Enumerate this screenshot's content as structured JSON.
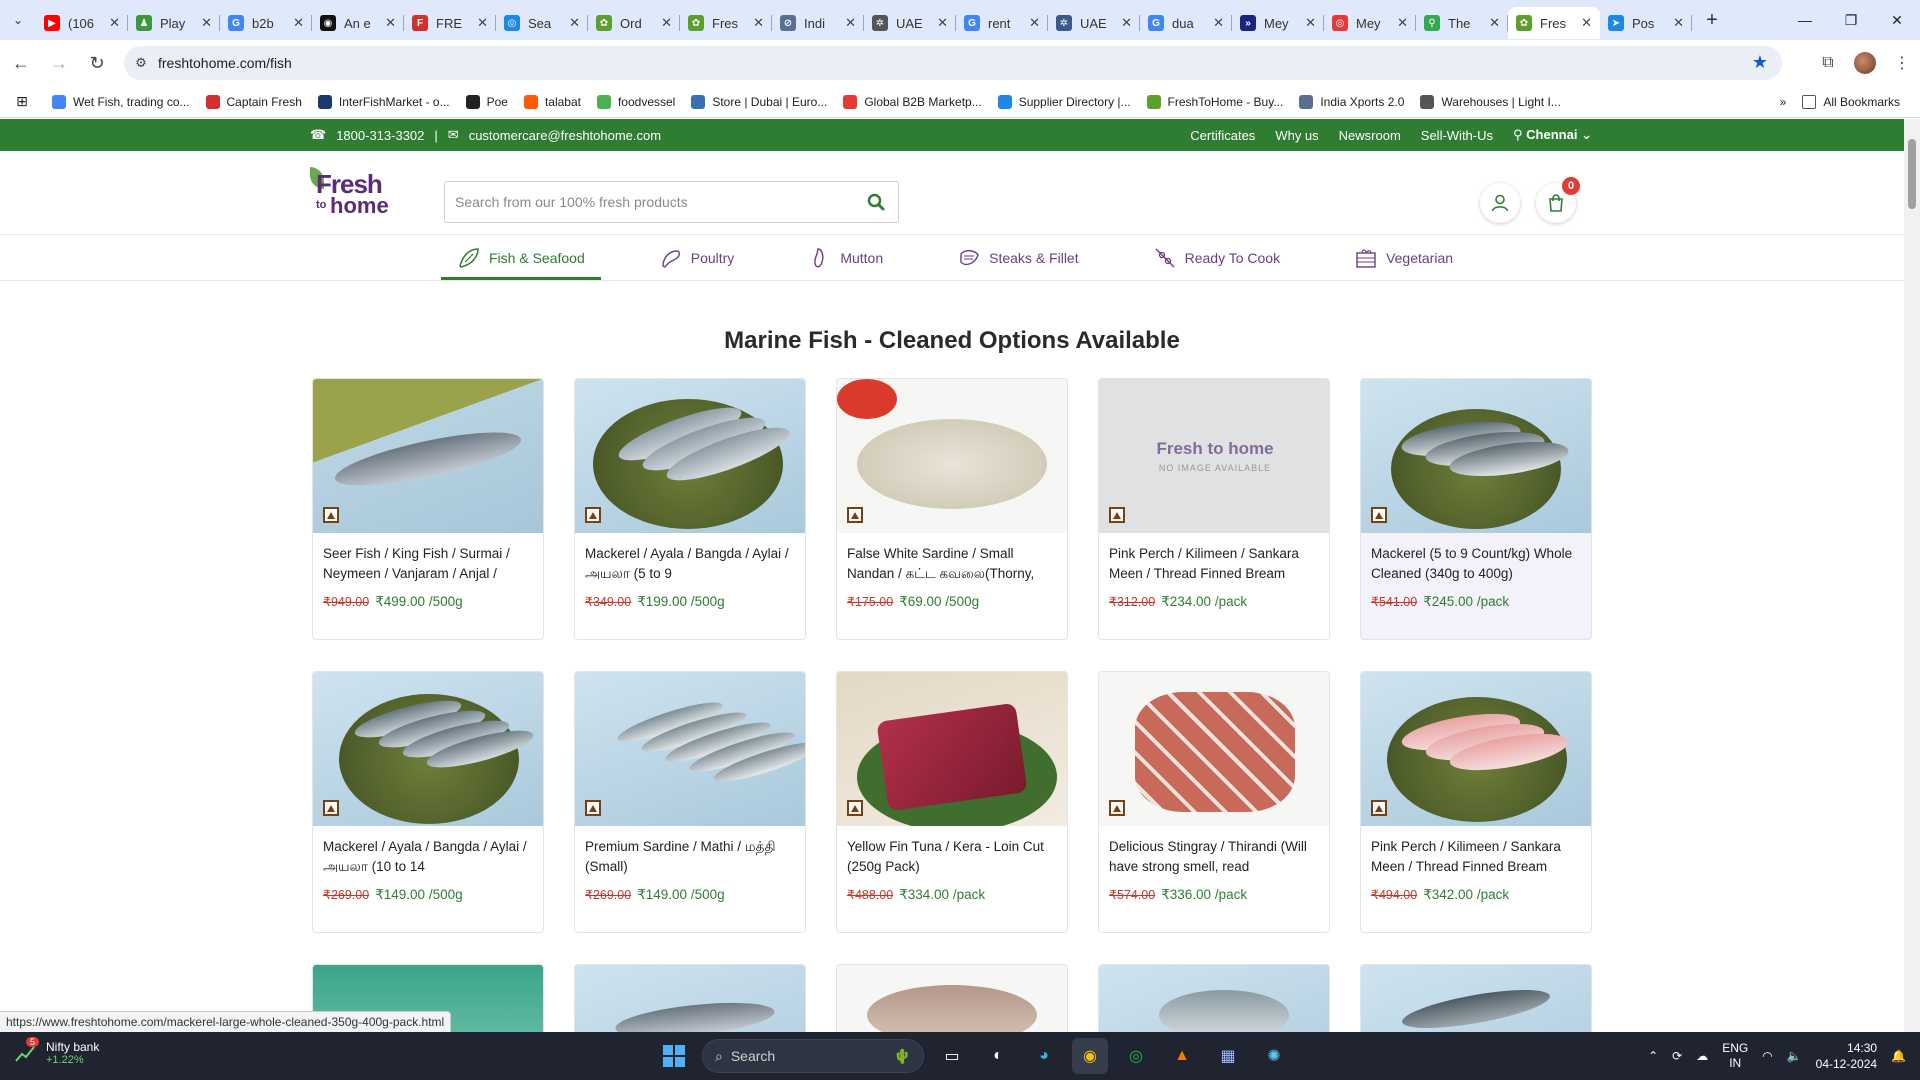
{
  "browser": {
    "tabs": [
      {
        "title": "(106",
        "color": "#ff0000",
        "glyph": "▶"
      },
      {
        "title": "Play",
        "color": "#3a9a3a",
        "glyph": "♟"
      },
      {
        "title": "b2b",
        "color": "#4285f4",
        "glyph": "G"
      },
      {
        "title": "An e",
        "color": "#111111",
        "glyph": "◉"
      },
      {
        "title": "FRE",
        "color": "#d32f2f",
        "glyph": "F"
      },
      {
        "title": "Sea",
        "color": "#1e88e5",
        "glyph": "◎"
      },
      {
        "title": "Ord",
        "color": "#5aa02c",
        "glyph": "✿"
      },
      {
        "title": "Fres",
        "color": "#5aa02c",
        "glyph": "✿"
      },
      {
        "title": "Indi",
        "color": "#5a6f8f",
        "glyph": "⊘"
      },
      {
        "title": "UAE",
        "color": "#555555",
        "glyph": "✲"
      },
      {
        "title": "rent",
        "color": "#4285f4",
        "glyph": "G"
      },
      {
        "title": "UAE",
        "color": "#3b5a8a",
        "glyph": "✲"
      },
      {
        "title": "dua",
        "color": "#4285f4",
        "glyph": "G"
      },
      {
        "title": "Mey",
        "color": "#1a237e",
        "glyph": "»"
      },
      {
        "title": "Mey",
        "color": "#e53935",
        "glyph": "◎"
      },
      {
        "title": "The",
        "color": "#34a853",
        "glyph": "⚲"
      },
      {
        "title": "Fres",
        "color": "#5aa02c",
        "glyph": "✿"
      },
      {
        "title": "Pos",
        "color": "#1e88e5",
        "glyph": "➤"
      }
    ],
    "active_tab_index": 16,
    "url": "freshtohome.com/fish",
    "bookmarks": [
      {
        "label": "Wet Fish, trading co...",
        "color": "#4285f4"
      },
      {
        "label": "Captain Fresh",
        "color": "#d32f2f"
      },
      {
        "label": "InterFishMarket - o...",
        "color": "#1a3a6b"
      },
      {
        "label": "Poe",
        "color": "#222222"
      },
      {
        "label": "talabat",
        "color": "#ff5a00"
      },
      {
        "label": "foodvessel",
        "color": "#4caf50"
      },
      {
        "label": "Store | Dubai | Euro...",
        "color": "#3a6fb0"
      },
      {
        "label": "Global B2B Marketp...",
        "color": "#e53935"
      },
      {
        "label": "Supplier Directory |...",
        "color": "#1e88e5"
      },
      {
        "label": "FreshToHome - Buy...",
        "color": "#5aa02c"
      },
      {
        "label": "India Xports 2.0",
        "color": "#5a6f8f"
      },
      {
        "label": "Warehouses | Light I...",
        "color": "#555555"
      }
    ],
    "all_bookmarks": "All Bookmarks",
    "status_url": "https://www.freshtohome.com/mackerel-large-whole-cleaned-350g-400g-pack.html"
  },
  "site": {
    "phone": "1800-313-3302",
    "email": "customercare@freshtohome.com",
    "top_links": [
      "Certificates",
      "Why us",
      "Newsroom",
      "Sell-With-Us"
    ],
    "city": "Chennai",
    "logo": {
      "line1": "Fresh",
      "line2": "to",
      "line3": "home"
    },
    "search_placeholder": "Search from our 100% fresh products",
    "cart_count": "0",
    "categories": [
      "Fish & Seafood",
      "Poultry",
      "Mutton",
      "Steaks & Fillet",
      "Ready To Cook",
      "Vegetarian"
    ],
    "heading": "Marine Fish - Cleaned Options Available",
    "no_image": {
      "brand": "Fresh to home",
      "text": "NO IMAGE AVAILABLE"
    }
  },
  "products": [
    {
      "name": "Seer Fish / King Fish / Surmai / Neymeen / Vanjaram / Anjal /",
      "old": "₹949.00",
      "price": "₹499.00 /500g"
    },
    {
      "name": "Mackerel / Ayala / Bangda / Aylai / அயலா (5 to 9",
      "old": "₹349.00",
      "price": "₹199.00 /500g"
    },
    {
      "name": "False White Sardine / Small Nandan / கட்ட கவலை(Thorny,",
      "old": "₹175.00",
      "price": "₹69.00 /500g"
    },
    {
      "name": "Pink Perch / Kilimeen / Sankara Meen / Thread Finned Bream",
      "old": "₹312.00",
      "price": "₹234.00 /pack"
    },
    {
      "name": "Mackerel (5 to 9 Count/kg) Whole Cleaned (340g to 400g)",
      "old": "₹541.00",
      "price": "₹245.00 /pack"
    },
    {
      "name": "Mackerel / Ayala / Bangda / Aylai / அயலா (10 to 14",
      "old": "₹269.00",
      "price": "₹149.00 /500g"
    },
    {
      "name": "Premium Sardine / Mathi / மத்தி (Small)",
      "old": "₹269.00",
      "price": "₹149.00 /500g"
    },
    {
      "name": "Yellow Fin Tuna / Kera - Loin Cut (250g Pack)",
      "old": "₹488.00",
      "price": "₹334.00 /pack"
    },
    {
      "name": "Delicious Stingray / Thirandi (Will have strong smell, read",
      "old": "₹574.00",
      "price": "₹336.00 /pack"
    },
    {
      "name": "Pink Perch / Kilimeen / Sankara Meen / Thread Finned Bream",
      "old": "₹494.00",
      "price": "₹342.00 /pack"
    }
  ],
  "taskbar": {
    "ticker_name": "Nifty bank",
    "ticker_change": "+1.22%",
    "ticker_badge": "5",
    "search_label": "Search",
    "lang": "ENG",
    "region": "IN",
    "time": "14:30",
    "date": "04-12-2024"
  }
}
